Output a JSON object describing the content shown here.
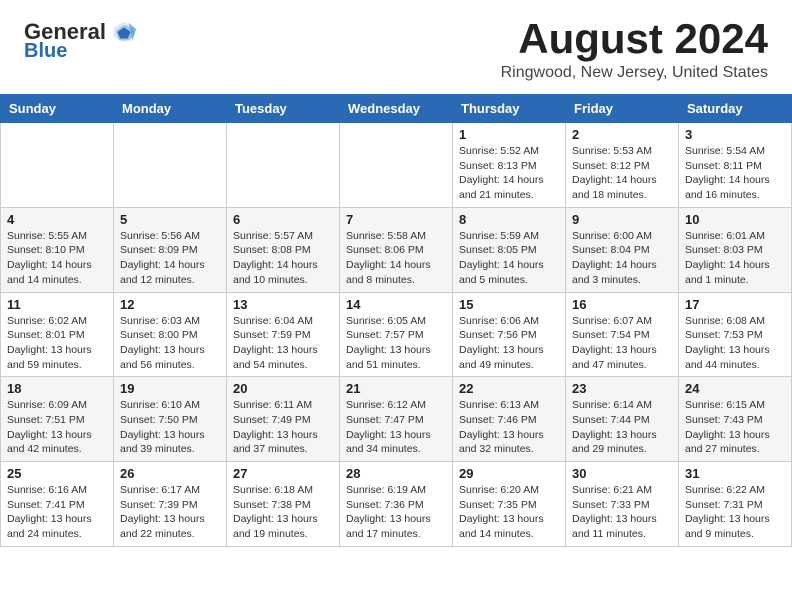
{
  "header": {
    "logo_general": "General",
    "logo_blue": "Blue",
    "month_title": "August 2024",
    "location": "Ringwood, New Jersey, United States"
  },
  "weekdays": [
    "Sunday",
    "Monday",
    "Tuesday",
    "Wednesday",
    "Thursday",
    "Friday",
    "Saturday"
  ],
  "weeks": [
    [
      {
        "day": "",
        "info": ""
      },
      {
        "day": "",
        "info": ""
      },
      {
        "day": "",
        "info": ""
      },
      {
        "day": "",
        "info": ""
      },
      {
        "day": "1",
        "info": "Sunrise: 5:52 AM\nSunset: 8:13 PM\nDaylight: 14 hours\nand 21 minutes."
      },
      {
        "day": "2",
        "info": "Sunrise: 5:53 AM\nSunset: 8:12 PM\nDaylight: 14 hours\nand 18 minutes."
      },
      {
        "day": "3",
        "info": "Sunrise: 5:54 AM\nSunset: 8:11 PM\nDaylight: 14 hours\nand 16 minutes."
      }
    ],
    [
      {
        "day": "4",
        "info": "Sunrise: 5:55 AM\nSunset: 8:10 PM\nDaylight: 14 hours\nand 14 minutes."
      },
      {
        "day": "5",
        "info": "Sunrise: 5:56 AM\nSunset: 8:09 PM\nDaylight: 14 hours\nand 12 minutes."
      },
      {
        "day": "6",
        "info": "Sunrise: 5:57 AM\nSunset: 8:08 PM\nDaylight: 14 hours\nand 10 minutes."
      },
      {
        "day": "7",
        "info": "Sunrise: 5:58 AM\nSunset: 8:06 PM\nDaylight: 14 hours\nand 8 minutes."
      },
      {
        "day": "8",
        "info": "Sunrise: 5:59 AM\nSunset: 8:05 PM\nDaylight: 14 hours\nand 5 minutes."
      },
      {
        "day": "9",
        "info": "Sunrise: 6:00 AM\nSunset: 8:04 PM\nDaylight: 14 hours\nand 3 minutes."
      },
      {
        "day": "10",
        "info": "Sunrise: 6:01 AM\nSunset: 8:03 PM\nDaylight: 14 hours\nand 1 minute."
      }
    ],
    [
      {
        "day": "11",
        "info": "Sunrise: 6:02 AM\nSunset: 8:01 PM\nDaylight: 13 hours\nand 59 minutes."
      },
      {
        "day": "12",
        "info": "Sunrise: 6:03 AM\nSunset: 8:00 PM\nDaylight: 13 hours\nand 56 minutes."
      },
      {
        "day": "13",
        "info": "Sunrise: 6:04 AM\nSunset: 7:59 PM\nDaylight: 13 hours\nand 54 minutes."
      },
      {
        "day": "14",
        "info": "Sunrise: 6:05 AM\nSunset: 7:57 PM\nDaylight: 13 hours\nand 51 minutes."
      },
      {
        "day": "15",
        "info": "Sunrise: 6:06 AM\nSunset: 7:56 PM\nDaylight: 13 hours\nand 49 minutes."
      },
      {
        "day": "16",
        "info": "Sunrise: 6:07 AM\nSunset: 7:54 PM\nDaylight: 13 hours\nand 47 minutes."
      },
      {
        "day": "17",
        "info": "Sunrise: 6:08 AM\nSunset: 7:53 PM\nDaylight: 13 hours\nand 44 minutes."
      }
    ],
    [
      {
        "day": "18",
        "info": "Sunrise: 6:09 AM\nSunset: 7:51 PM\nDaylight: 13 hours\nand 42 minutes."
      },
      {
        "day": "19",
        "info": "Sunrise: 6:10 AM\nSunset: 7:50 PM\nDaylight: 13 hours\nand 39 minutes."
      },
      {
        "day": "20",
        "info": "Sunrise: 6:11 AM\nSunset: 7:49 PM\nDaylight: 13 hours\nand 37 minutes."
      },
      {
        "day": "21",
        "info": "Sunrise: 6:12 AM\nSunset: 7:47 PM\nDaylight: 13 hours\nand 34 minutes."
      },
      {
        "day": "22",
        "info": "Sunrise: 6:13 AM\nSunset: 7:46 PM\nDaylight: 13 hours\nand 32 minutes."
      },
      {
        "day": "23",
        "info": "Sunrise: 6:14 AM\nSunset: 7:44 PM\nDaylight: 13 hours\nand 29 minutes."
      },
      {
        "day": "24",
        "info": "Sunrise: 6:15 AM\nSunset: 7:43 PM\nDaylight: 13 hours\nand 27 minutes."
      }
    ],
    [
      {
        "day": "25",
        "info": "Sunrise: 6:16 AM\nSunset: 7:41 PM\nDaylight: 13 hours\nand 24 minutes."
      },
      {
        "day": "26",
        "info": "Sunrise: 6:17 AM\nSunset: 7:39 PM\nDaylight: 13 hours\nand 22 minutes."
      },
      {
        "day": "27",
        "info": "Sunrise: 6:18 AM\nSunset: 7:38 PM\nDaylight: 13 hours\nand 19 minutes."
      },
      {
        "day": "28",
        "info": "Sunrise: 6:19 AM\nSunset: 7:36 PM\nDaylight: 13 hours\nand 17 minutes."
      },
      {
        "day": "29",
        "info": "Sunrise: 6:20 AM\nSunset: 7:35 PM\nDaylight: 13 hours\nand 14 minutes."
      },
      {
        "day": "30",
        "info": "Sunrise: 6:21 AM\nSunset: 7:33 PM\nDaylight: 13 hours\nand 11 minutes."
      },
      {
        "day": "31",
        "info": "Sunrise: 6:22 AM\nSunset: 7:31 PM\nDaylight: 13 hours\nand 9 minutes."
      }
    ]
  ]
}
